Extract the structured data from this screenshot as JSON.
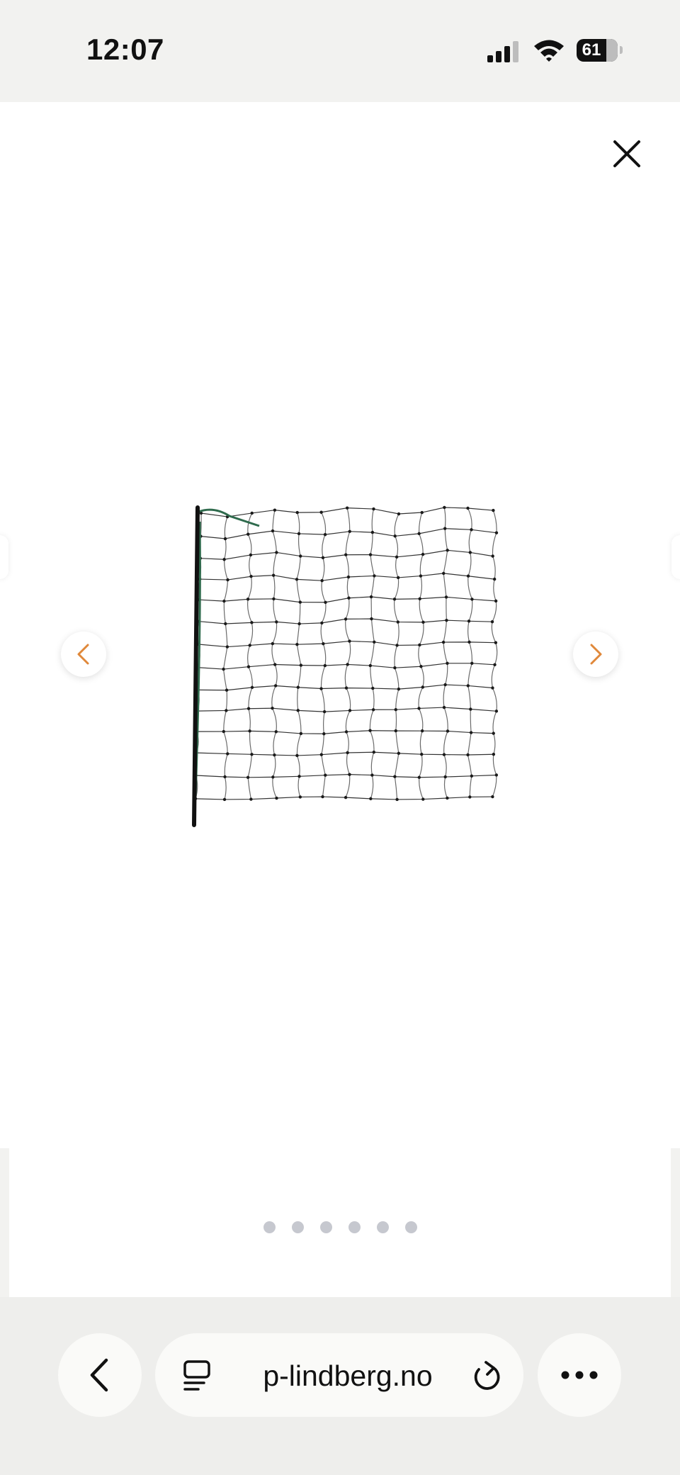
{
  "status_bar": {
    "time": "12:07",
    "battery": "61",
    "icons": [
      "cellular-signal-icon",
      "wifi-icon",
      "battery-icon"
    ]
  },
  "viewer": {
    "close_icon": "close-icon",
    "prev_icon": "chevron-left-icon",
    "next_icon": "chevron-right-icon",
    "image_subject": "fence-net-image",
    "slide_count": 6,
    "accent_color": "#e0883a"
  },
  "browser": {
    "address": "p-lindberg.no",
    "back_icon": "back-chevron-icon",
    "tabs_icon": "tabs-overview-icon",
    "reload_icon": "reload-icon",
    "more_icon": "more-icon"
  }
}
